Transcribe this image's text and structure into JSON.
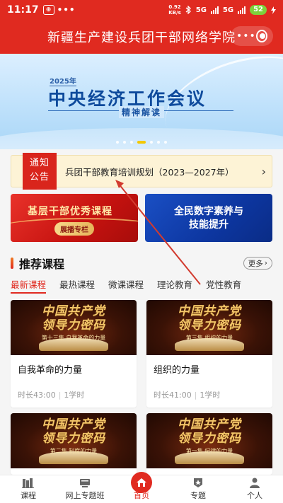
{
  "status_bar": {
    "time": "11:17",
    "app_badge": "⊕",
    "dots": "•••",
    "speed_value": "0.92",
    "speed_unit": "KB/s",
    "network1": "5G",
    "network2": "5G",
    "battery": "52",
    "charging_icon": "bolt-icon"
  },
  "header": {
    "title": "新疆生产建设兵团干部网络学院",
    "more_icon": "more-dots-icon",
    "close_icon": "target-icon"
  },
  "banner": {
    "year": "2025年",
    "title": "中央经济工作会议",
    "subtitle": "精神解读",
    "page_count": 7,
    "active_page": 4
  },
  "notice": {
    "tag_line1": "通知",
    "tag_line2": "公告",
    "text": "兵团干部教育培训规划（2023—2027年）",
    "chevron_icon": "chevron-right-icon"
  },
  "promos": {
    "left": {
      "title": "基层干部优秀课程",
      "pill": "展播专栏"
    },
    "right": {
      "line1": "全民数字素养与",
      "line2": "技能提升"
    }
  },
  "recommend": {
    "title": "推荐课程",
    "more": "更多",
    "more_icon": "chevron-right-icon"
  },
  "tabs": [
    {
      "label": "最新课程",
      "active": true
    },
    {
      "label": "最热课程",
      "active": false
    },
    {
      "label": "微课课程",
      "active": false
    },
    {
      "label": "理论教育",
      "active": false
    },
    {
      "label": "党性教育",
      "active": false
    }
  ],
  "courses": [
    {
      "thumb_title_1": "中国共产党",
      "thumb_title_2": "领导力密码",
      "thumb_sub": "第十三集 自我革命的力量",
      "name": "自我革命的力量",
      "duration": "时长43:00",
      "hours": "1学时"
    },
    {
      "thumb_title_1": "中国共产党",
      "thumb_title_2": "领导力密码",
      "thumb_sub": "第三集 组织的力量",
      "name": "组织的力量",
      "duration": "时长41:00",
      "hours": "1学时"
    },
    {
      "thumb_title_1": "中国共产党",
      "thumb_title_2": "领导力密码",
      "thumb_sub": "第二集 制度的力量"
    },
    {
      "thumb_title_1": "中国共产党",
      "thumb_title_2": "领导力密码",
      "thumb_sub": "第一集 纪律的力量"
    }
  ],
  "bottom_nav": [
    {
      "label": "课程",
      "icon": "books-icon",
      "active": false
    },
    {
      "label": "网上专题班",
      "icon": "classroom-icon",
      "active": false
    },
    {
      "label": "首页",
      "icon": "home-icon",
      "active": true
    },
    {
      "label": "专题",
      "icon": "star-shield-icon",
      "active": false
    },
    {
      "label": "个人",
      "icon": "person-icon",
      "active": false
    }
  ],
  "colors": {
    "brand_red": "#e02a20",
    "notice_bg": "#fdf3d6",
    "promo_blue": "#0d36a0",
    "accent_gold": "#f3c669"
  }
}
